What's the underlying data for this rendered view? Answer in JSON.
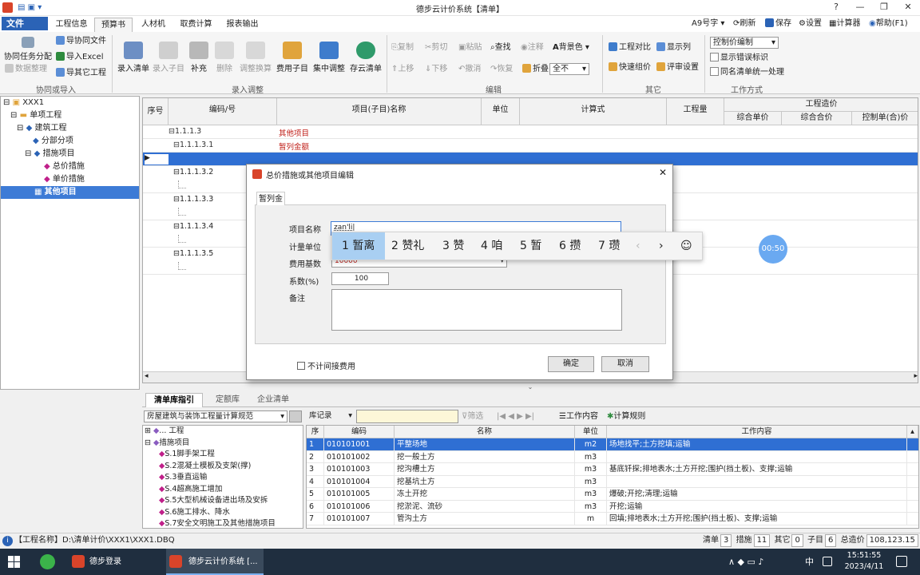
{
  "title": "德步云计价系统【清单】",
  "tabs": {
    "file": "文件",
    "items": [
      "工程信息",
      "预算书",
      "人材机",
      "取费计算",
      "报表输出"
    ]
  },
  "toolbar_right": {
    "font": "9号字",
    "refresh": "刷新",
    "save": "保存",
    "settings": "设置",
    "calculator": "计算器",
    "help": "帮助(F1)"
  },
  "ribbon": {
    "g1": {
      "cowork": "协同任务分配",
      "cowork_file": "导协同文件",
      "import_excel": "导入Excel",
      "data_clean": "数据整理",
      "import_other": "导其它工程",
      "label": "协同或导入"
    },
    "g2": {
      "b1": "录入清单",
      "b2": "录入子目",
      "b3": "补充",
      "b4": "删除",
      "b5": "调整换算",
      "b6": "费用子目",
      "b7": "集中调整",
      "b8": "存云清单",
      "label": "录入调整"
    },
    "g3": {
      "copy": "复制",
      "cut": "剪切",
      "paste": "粘贴",
      "find": "查找",
      "comment": "注释",
      "bgcolor": "背景色",
      "up": "上移",
      "down": "下移",
      "undo": "撤消",
      "redo": "恢复",
      "fold": "折叠",
      "fold_val": "全不",
      "label": "编辑"
    },
    "g4": {
      "compare": "工程对比",
      "showcol": "显示列",
      "quick": "快速组价",
      "audit": "评审设置",
      "label": "其它"
    },
    "g5": {
      "select": "控制价编制",
      "show_err": "显示错误标识",
      "same_name": "同名清单统一处理",
      "label": "工作方式"
    }
  },
  "tree": [
    "XXX1",
    "单项工程",
    "建筑工程",
    "分部分项",
    "措施项目",
    "总价措施",
    "单价措施",
    "其他项目"
  ],
  "grid": {
    "headers": {
      "seq": "序号",
      "code": "编码/号",
      "name": "项目(子目)名称",
      "unit": "单位",
      "formula": "计算式",
      "qty": "工程量",
      "price": "工程造价",
      "unit_price": "综合单价",
      "total": "综合合价",
      "ctrl": "控制单(合)价"
    },
    "rows": [
      {
        "code": "1.1.1.3",
        "name": "其他项目"
      },
      {
        "code": "1.1.1.3.1",
        "name": "暂列金额"
      },
      {
        "code": "",
        "name": ""
      },
      {
        "code": "1.1.1.3.2",
        "name": ""
      },
      {
        "code": "1.1.1.3.3",
        "name": ""
      },
      {
        "code": "1.1.1.3.4",
        "name": ""
      },
      {
        "code": "1.1.1.3.5",
        "name": ""
      }
    ]
  },
  "bottom": {
    "tabs": [
      "清单库指引",
      "定额库",
      "企业清单"
    ],
    "library": "房屋建筑与装饰工程量计算规范",
    "search_select": "库记录",
    "filter": "筛选",
    "work_content": "工作内容",
    "calc_rule": "计算规则",
    "tree": [
      "... 工程",
      "措施项目",
      "S.1脚手架工程",
      "S.2混凝土模板及支架(撑)",
      "S.3垂直运输",
      "S.4超高施工增加",
      "S.5大型机械设备进出场及安拆",
      "S.6施工排水、降水",
      "S.7安全文明施工及其他措施项目"
    ],
    "table_headers": {
      "seq": "序",
      "code": "编码",
      "name": "名称",
      "unit": "单位",
      "content": "工作内容"
    },
    "rows": [
      {
        "seq": "1",
        "code": "010101001",
        "name": "平整场地",
        "unit": "m2",
        "content": "场地找平;土方挖填;运输"
      },
      {
        "seq": "2",
        "code": "010101002",
        "name": "挖一般土方",
        "unit": "m3",
        "content": ""
      },
      {
        "seq": "3",
        "code": "010101003",
        "name": "挖沟槽土方",
        "unit": "m3",
        "content": "基底钎探;排地表水;土方开挖;围护(挡土板)、支撑;运输"
      },
      {
        "seq": "4",
        "code": "010101004",
        "name": "挖基坑土方",
        "unit": "m3",
        "content": ""
      },
      {
        "seq": "5",
        "code": "010101005",
        "name": "冻土开挖",
        "unit": "m3",
        "content": "爆破;开挖;清理;运输"
      },
      {
        "seq": "6",
        "code": "010101006",
        "name": "挖淤泥、流砂",
        "unit": "m3",
        "content": "开挖;运输"
      },
      {
        "seq": "7",
        "code": "010101007",
        "name": "管沟土方",
        "unit": "m",
        "content": "回填;排地表水;土方开挖;围护(挡土板)、支撑;运输"
      }
    ]
  },
  "status": {
    "path": "【工程名称】D:\\清单计价\\XXX1\\XXX1.DBQ",
    "qd": "清单",
    "qd_n": "3",
    "cs": "措施",
    "cs_n": "11",
    "qt": "其它",
    "qt_n": "0",
    "zm": "子目",
    "zm_n": "6",
    "total_label": "总造价",
    "total": "108,123.15"
  },
  "taskbar": {
    "app1": "德步登录",
    "app2": "德步云计价系统 [...",
    "time": "15:51:55",
    "date": "2023/4/11",
    "lang": "中"
  },
  "dialog": {
    "title": "总价措施或其他项目编辑",
    "tab": "暂列金",
    "name_label": "项目名称",
    "name_value": "zan'li",
    "unit_label": "计量单位",
    "base_label": "费用基数",
    "base_value": "10000",
    "coef_label": "系数(%)",
    "coef_value": "100",
    "note_label": "备注",
    "checkbox": "不计间接费用",
    "ok": "确定",
    "cancel": "取消"
  },
  "ime": {
    "candidates": [
      "1 暂离",
      "2 赞礼",
      "3 赞",
      "4 咱",
      "5 暂",
      "6 攒",
      "7 瓒"
    ]
  },
  "timer": "00:50"
}
